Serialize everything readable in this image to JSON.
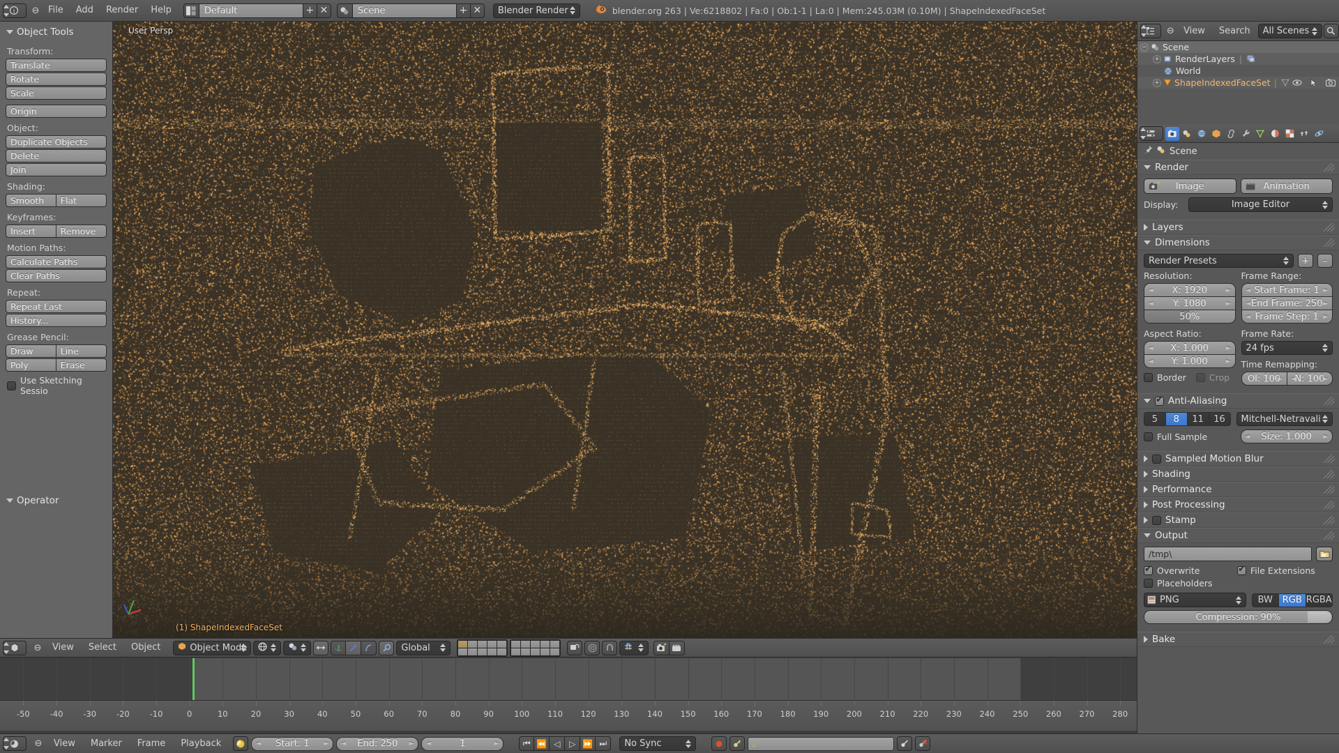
{
  "topbar": {
    "editor_icon": "info-editor-icon",
    "menus": [
      "File",
      "Add",
      "Render",
      "Help"
    ],
    "layout_icon": "screen-layout-icon",
    "layout_name": "Default",
    "layout_add": "+",
    "layout_delete": "✕",
    "scene_icon": "scene-icon",
    "scene_name": "Scene",
    "scene_add": "+",
    "scene_delete": "✕",
    "engine": "Blender Render",
    "version_icon": "blender-logo-icon",
    "stats": "blender.org 263 | Ve:6218802 | Fa:0 | Ob:1-1 | La:0 | Mem:245.03M (0.10M) | ShapeIndexedFaceSet"
  },
  "toolshelf": {
    "title": "Object Tools",
    "groups": [
      {
        "label": "Transform:",
        "buttons": [
          "Translate",
          "Rotate",
          "Scale"
        ]
      },
      {
        "label": "",
        "buttons": [
          "Origin"
        ]
      },
      {
        "label": "Object:",
        "buttons": [
          "Duplicate Objects",
          "Delete",
          "Join"
        ]
      },
      {
        "label": "Shading:",
        "row": [
          "Smooth",
          "Flat"
        ]
      },
      {
        "label": "Keyframes:",
        "row": [
          "Insert",
          "Remove"
        ]
      },
      {
        "label": "Motion Paths:",
        "buttons": [
          "Calculate Paths",
          "Clear Paths"
        ]
      },
      {
        "label": "Repeat:",
        "buttons": [
          "Repeat Last",
          "History..."
        ]
      },
      {
        "label": "Grease Pencil:",
        "row": [
          "Draw",
          "Line"
        ],
        "row2": [
          "Poly",
          "Erase"
        ],
        "checkbox": {
          "label": "Use Sketching Sessio",
          "checked": false
        }
      }
    ],
    "operator_title": "Operator"
  },
  "viewport": {
    "view_label": "User Persp",
    "object_label": "(1) ShapeIndexedFaceSet",
    "bg_color": "#3a3226",
    "point_color": "#f0a95a"
  },
  "viewport_footer": {
    "editor_icon": "3d-view-editor-icon",
    "menus": [
      "View",
      "Select",
      "Object"
    ],
    "mode_icon": "object-mode-icon",
    "mode": "Object Mode",
    "shading_icon": "viewport-shading-icon",
    "pivot_icon": "pivot-point-icon",
    "manipulator_icons": [
      "translate-manipulator-icon",
      "rotate-manipulator-icon",
      "scale-manipulator-icon"
    ],
    "orientation": "Global",
    "snap_icon": "snap-magnet-icon",
    "proportional_icon": "proportional-edit-icon",
    "render_icon": "render-image-icon",
    "animation_icon": "render-animation-icon"
  },
  "timeline": {
    "ticks": [
      -50,
      -40,
      -30,
      -20,
      -10,
      0,
      10,
      20,
      30,
      40,
      50,
      60,
      70,
      80,
      90,
      100,
      110,
      120,
      130,
      140,
      150,
      160,
      170,
      180,
      190,
      200,
      210,
      220,
      230,
      240,
      250,
      260,
      270,
      280
    ],
    "playhead_frame": 1,
    "range_start": 1,
    "range_end": 250,
    "axis_min": -57,
    "axis_max": 285
  },
  "timeline_footer": {
    "editor_icon": "timeline-editor-icon",
    "menus": [
      "View",
      "Marker",
      "Frame",
      "Playback"
    ],
    "pause_icon": "playhead-lock-icon",
    "start_label": "Start: 1",
    "end_label": "End: 250",
    "current_frame": "1",
    "transport": [
      "jump-to-start-icon",
      "step-back-icon",
      "play-reverse-icon",
      "play-icon",
      "step-forward-icon",
      "jump-to-end-icon"
    ],
    "sync_mode": "No Sync",
    "record_icon": "record-icon",
    "keying_icon": "keying-set-icon",
    "keyingset_value": "",
    "add_keyframe_icon": "add-keyframe-icon",
    "remove_keyframe_icon": "remove-keyframe-icon"
  },
  "outliner": {
    "editor_icon": "outliner-editor-icon",
    "menus": [
      "View",
      "Search"
    ],
    "display_mode": "All Scenes",
    "filter_icon": "search-icon",
    "rows": [
      {
        "name": "Scene",
        "icon": "scene-icon",
        "indent": 0,
        "expander": "minus",
        "selected": true
      },
      {
        "name": "RenderLayers",
        "icon": "renderlayers-icon",
        "indent": 1,
        "expander": "plus",
        "extra_icon": "renderlayers-data-icon"
      },
      {
        "name": "World",
        "icon": "world-icon",
        "indent": 1,
        "expander": "none"
      },
      {
        "name": "ShapeIndexedFaceSet",
        "icon": "mesh-object-icon",
        "indent": 0,
        "expander": "plus",
        "extra_icon": "mesh-data-icon",
        "restrict": [
          "eye-icon",
          "cursor-select-icon",
          "camera-icon"
        ]
      }
    ]
  },
  "properties": {
    "tabs": [
      {
        "name": "render-tab",
        "icon": "camera-back-icon",
        "active": true
      },
      {
        "name": "scene-tab",
        "icon": "scene-icon",
        "active": false
      },
      {
        "name": "world-tab",
        "icon": "world-icon",
        "active": false
      },
      {
        "name": "object-tab",
        "icon": "cube-icon",
        "active": false
      },
      {
        "name": "constraints-tab",
        "icon": "chain-icon",
        "active": false
      },
      {
        "name": "modifiers-tab",
        "icon": "wrench-icon",
        "active": false
      },
      {
        "name": "data-tab",
        "icon": "mesh-data-icon",
        "active": false
      },
      {
        "name": "material-tab",
        "icon": "material-sphere-icon",
        "active": false
      },
      {
        "name": "texture-tab",
        "icon": "checker-icon",
        "active": false
      },
      {
        "name": "particles-tab",
        "icon": "particles-icon",
        "active": false
      },
      {
        "name": "physics-tab",
        "icon": "physics-icon",
        "active": false
      }
    ],
    "breadcrumb": {
      "pin_icon": "pin-icon",
      "icon": "scene-icon",
      "label": "Scene"
    },
    "render": {
      "title": "Render",
      "image_button": "Image",
      "image_icon": "render-image-icon",
      "animation_button": "Animation",
      "animation_icon": "render-animation-icon",
      "display_label": "Display:",
      "display_value": "Image Editor"
    },
    "layers": {
      "title": "Layers",
      "collapsed": true
    },
    "dimensions": {
      "title": "Dimensions",
      "preset": "Render Presets",
      "preset_add": "+",
      "preset_remove": "–",
      "resolution_label": "Resolution:",
      "res_x": "X: 1920",
      "res_y": "Y: 1080",
      "res_percent": "50%",
      "res_percent_value": 50,
      "frame_range_label": "Frame Range:",
      "start_frame": "Start Frame: 1",
      "end_frame": "End Frame: 250",
      "frame_step": "Frame Step: 1",
      "aspect_label": "Aspect Ratio:",
      "aspect_x": "X: 1.000",
      "aspect_y": "Y: 1.000",
      "border": {
        "label": "Border",
        "checked": false
      },
      "crop": {
        "label": "Crop",
        "checked": false,
        "disabled": true
      },
      "frame_rate_label": "Frame Rate:",
      "frame_rate": "24 fps",
      "time_remapping_label": "Time Remapping:",
      "old_map": "Ol: 100",
      "new_map": "N: 100"
    },
    "antialiasing": {
      "title": "Anti-Aliasing",
      "checked": true,
      "samples": [
        "5",
        "8",
        "11",
        "16"
      ],
      "active_sample": "8",
      "filter": "Mitchell-Netravali",
      "full_sample": {
        "label": "Full Sample",
        "checked": false
      },
      "size": "Size: 1.000"
    },
    "collapsed_sections": [
      {
        "title": "Sampled Motion Blur",
        "checkbox": true,
        "checked": false
      },
      {
        "title": "Shading",
        "checkbox": false
      },
      {
        "title": "Performance",
        "checkbox": false
      },
      {
        "title": "Post Processing",
        "checkbox": false
      },
      {
        "title": "Stamp",
        "checkbox": true,
        "checked": false
      }
    ],
    "output": {
      "title": "Output",
      "path": "/tmp\\",
      "folder_icon": "folder-icon",
      "overwrite": {
        "label": "Overwrite",
        "checked": true
      },
      "file_extensions": {
        "label": "File Extensions",
        "checked": true
      },
      "placeholders": {
        "label": "Placeholders",
        "checked": false
      },
      "format_icon": "image-file-icon",
      "format": "PNG",
      "color_modes": [
        "BW",
        "RGB",
        "RGBA"
      ],
      "active_color_mode": "RGB",
      "compression": "Compression: 90%",
      "compression_value": 90
    },
    "bake": {
      "title": "Bake",
      "collapsed": true
    }
  },
  "colors": {
    "accent_blue": "#3d78cf",
    "header_gray": "#565656",
    "panel_gray": "#585858",
    "toolshelf_gray": "#656565",
    "viewport_bg": "#3a3226",
    "point_orange": "#f0a95a",
    "playhead_green": "#5ec85e"
  }
}
